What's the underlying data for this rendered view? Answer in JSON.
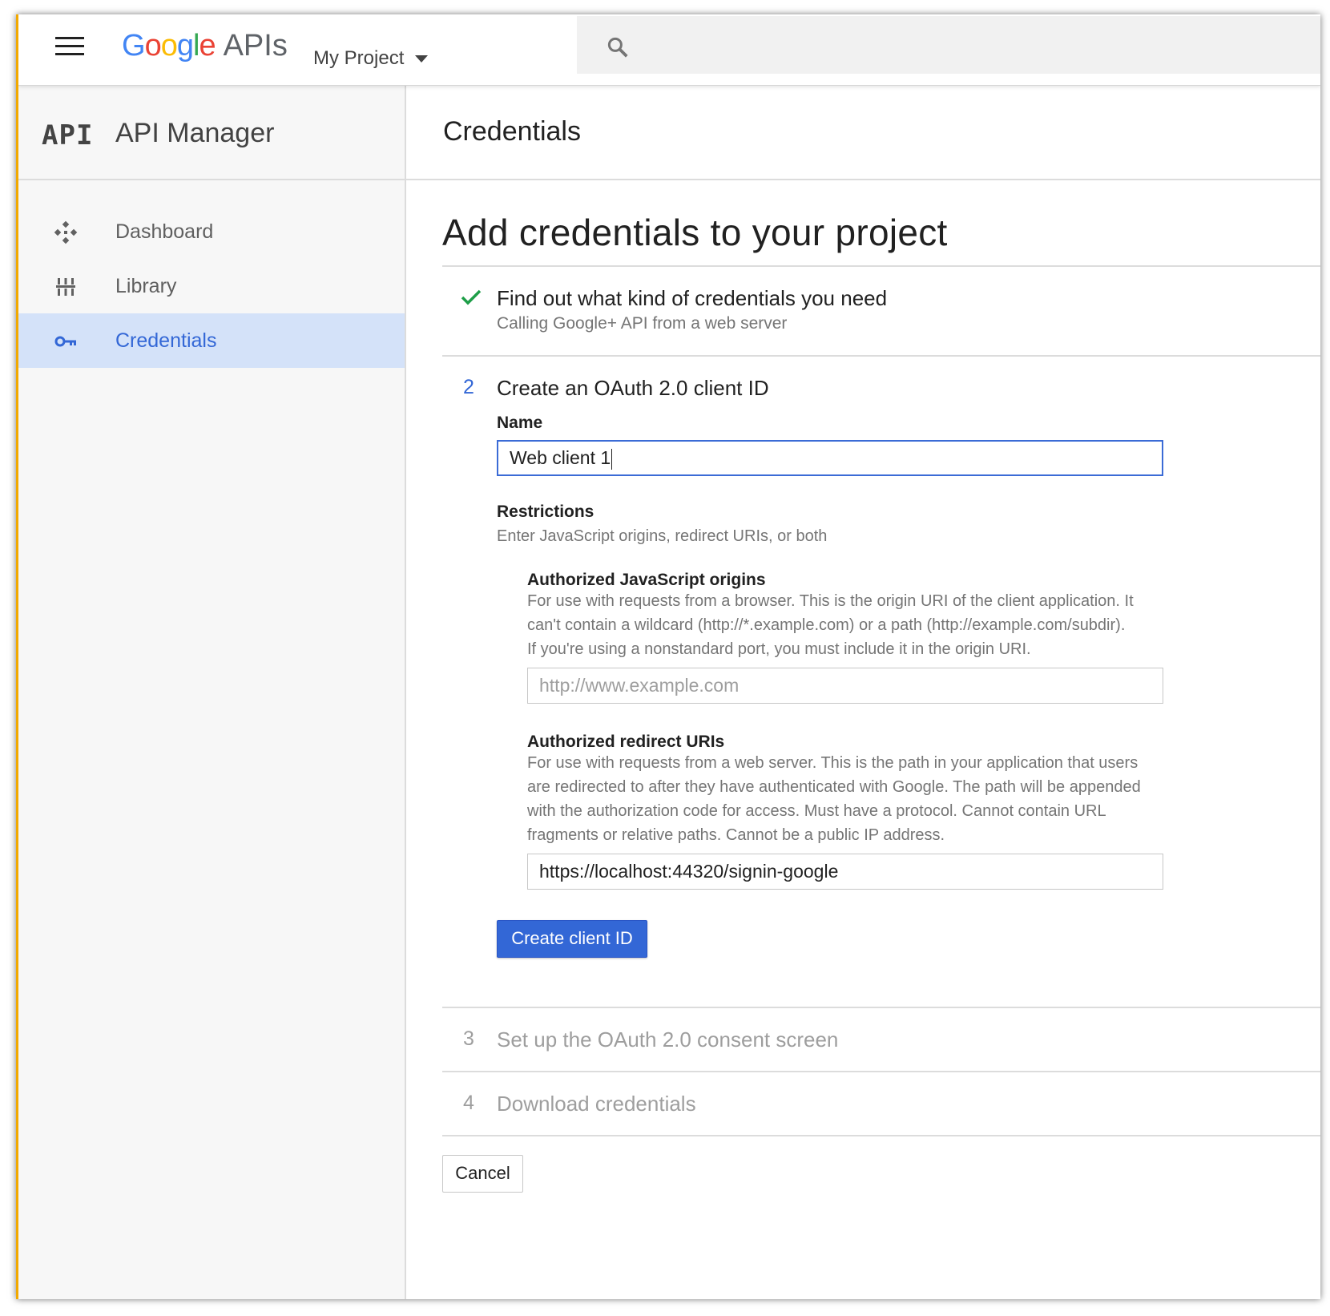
{
  "header": {
    "brand_google": "Google",
    "brand_apis": "APIs",
    "project_name": "My Project"
  },
  "sidebar": {
    "logo_text": "API",
    "title": "API Manager",
    "items": [
      {
        "label": "Dashboard",
        "icon": "dashboard-icon",
        "active": false
      },
      {
        "label": "Library",
        "icon": "library-icon",
        "active": false
      },
      {
        "label": "Credentials",
        "icon": "key-icon",
        "active": true
      }
    ]
  },
  "main": {
    "page_title": "Credentials",
    "heading": "Add credentials to your project",
    "step1": {
      "title": "Find out what kind of credentials you need",
      "subtitle": "Calling Google+ API from a web server",
      "status": "completed"
    },
    "step2": {
      "number": "2",
      "title": "Create an OAuth 2.0 client ID",
      "name_label": "Name",
      "name_value": "Web client 1",
      "restrictions_label": "Restrictions",
      "restrictions_help": "Enter JavaScript origins, redirect URIs, or both",
      "js_origins_label": "Authorized JavaScript origins",
      "js_origins_help_1": "For use with requests from a browser. This is the origin URI of the client application. It",
      "js_origins_help_2": "can't contain a wildcard (http://*.example.com) or a path (http://example.com/subdir).",
      "js_origins_help_3": "If you're using a nonstandard port, you must include it in the origin URI.",
      "js_origins_placeholder": "http://www.example.com",
      "redirect_label": "Authorized redirect URIs",
      "redirect_help_1": "For use with requests from a web server. This is the path in your application that users",
      "redirect_help_2": "are redirected to after they have authenticated with Google. The path will be appended",
      "redirect_help_3": "with the authorization code for access. Must have a protocol. Cannot contain URL",
      "redirect_help_4": "fragments or relative paths. Cannot be a public IP address.",
      "redirect_value": "https://localhost:44320/signin-google",
      "create_button": "Create client ID"
    },
    "step3": {
      "number": "3",
      "title": "Set up the OAuth 2.0 consent screen"
    },
    "step4": {
      "number": "4",
      "title": "Download credentials"
    },
    "cancel_button": "Cancel"
  },
  "colors": {
    "accent": "#3367d6",
    "active_nav_bg": "#d4e2f9",
    "check": "#1e9e48"
  }
}
